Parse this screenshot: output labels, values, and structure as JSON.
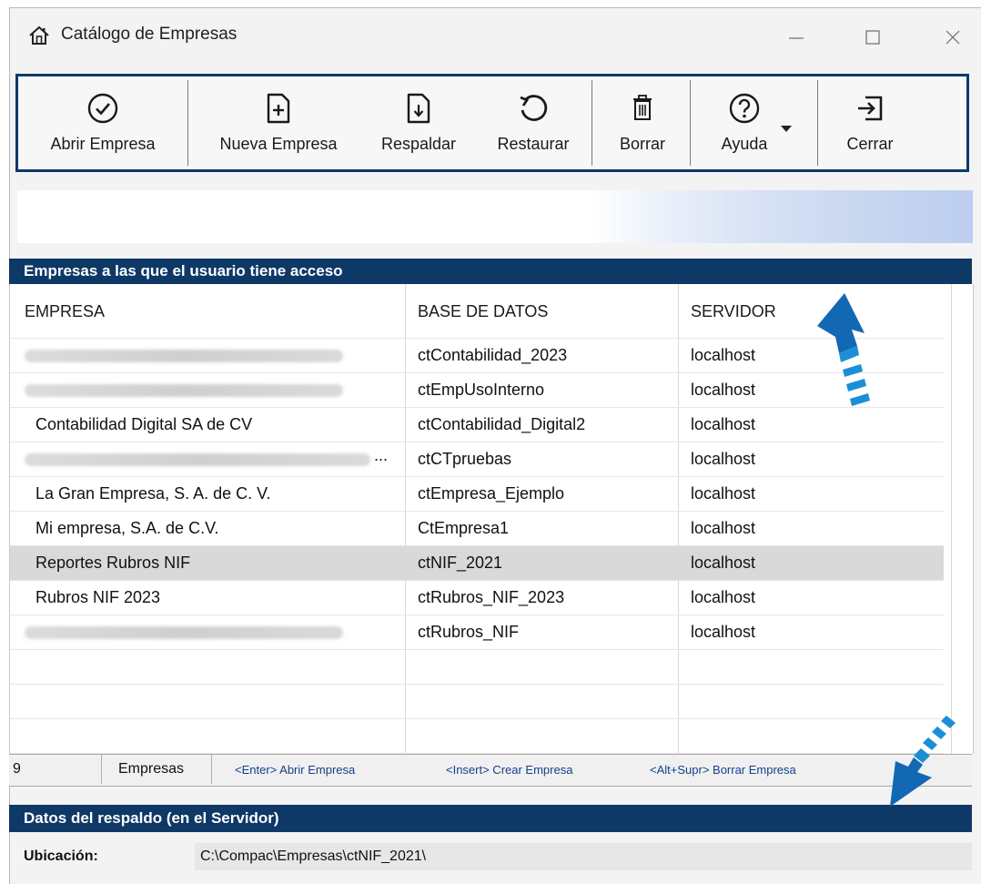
{
  "window": {
    "title": "Catálogo de Empresas"
  },
  "toolbar": {
    "open_label": "Abrir Empresa",
    "new_label": "Nueva Empresa",
    "backup_label": "Respaldar",
    "restore_label": "Restaurar",
    "delete_label": "Borrar",
    "help_label": "Ayuda",
    "close_label": "Cerrar"
  },
  "grid": {
    "title": "Empresas a las que el usuario tiene acceso",
    "columns": [
      "EMPRESA",
      "BASE DE DATOS",
      "SERVIDOR"
    ],
    "rows": [
      {
        "empresa": "",
        "base": "ctContabilidad_2023",
        "servidor": "localhost",
        "redacted": true
      },
      {
        "empresa": "",
        "base": "ctEmpUsoInterno",
        "servidor": "localhost",
        "redacted": true
      },
      {
        "empresa": "Contabilidad Digital SA de CV",
        "base": "ctContabilidad_Digital2",
        "servidor": "localhost",
        "redacted": false
      },
      {
        "empresa": "...",
        "base": "ctCTpruebas",
        "servidor": "localhost",
        "redacted": true
      },
      {
        "empresa": "La Gran Empresa, S. A. de C. V.",
        "base": "ctEmpresa_Ejemplo",
        "servidor": "localhost",
        "redacted": false
      },
      {
        "empresa": "Mi empresa, S.A. de C.V.",
        "base": "CtEmpresa1",
        "servidor": "localhost",
        "redacted": false
      },
      {
        "empresa": "Reportes Rubros NIF",
        "base": "ctNIF_2021",
        "servidor": "localhost",
        "redacted": false,
        "selected": true
      },
      {
        "empresa": "Rubros NIF 2023",
        "base": "ctRubros_NIF_2023",
        "servidor": "localhost",
        "redacted": false
      },
      {
        "empresa": "",
        "base": "ctRubros_NIF",
        "servidor": "localhost",
        "redacted": true
      }
    ]
  },
  "status": {
    "count": "9",
    "count_label": "Empresas",
    "hint_open": "<Enter> Abrir Empresa",
    "hint_create": "<Insert> Crear Empresa",
    "hint_delete": "<Alt+Supr> Borrar Empresa"
  },
  "backup": {
    "title": "Datos del respaldo (en el Servidor)",
    "location_label": "Ubicación:",
    "location_value": "C:\\Compac\\Empresas\\ctNIF_2021\\"
  },
  "colors": {
    "header_bg": "#0e3866",
    "toolbar_border": "#0c3a67",
    "arrow": "#1279c8",
    "selected_row": "#d9d9d9"
  }
}
